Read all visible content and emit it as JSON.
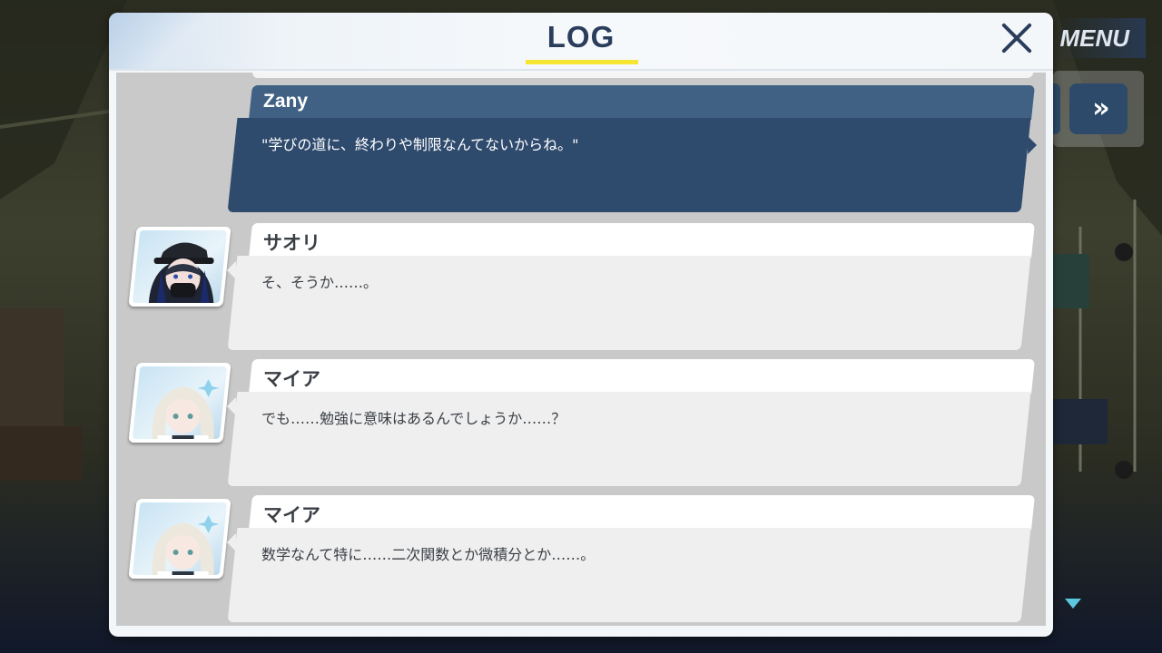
{
  "window": {
    "title": "LOG"
  },
  "top_controls": {
    "menu_label": "MENU",
    "skip_label": "»",
    "auto_label": ""
  },
  "log_entries": [
    {
      "speaker": "Zany",
      "text": "\"学びの道に、終わりや制限なんてないからね。\"",
      "type": "player"
    },
    {
      "speaker": "サオリ",
      "text": "そ、そうか……。",
      "type": "npc",
      "avatar": "saori-portrait"
    },
    {
      "speaker": "マイア",
      "text": "でも……勉強に意味はあるんでしょうか……？",
      "type": "npc",
      "avatar": "maia-portrait"
    },
    {
      "speaker": "マイア",
      "text": "数学なんて特に……二次関数とか微積分とか……。",
      "type": "npc",
      "avatar": "maia-portrait"
    }
  ],
  "colors": {
    "title_underline": "#f7e533",
    "player_bubble": "#2e4a6d",
    "player_name_bar": "#406184",
    "npc_bubble": "#efefef",
    "accent_dark": "#2a3e5c"
  },
  "icons": {
    "close": "close-icon",
    "skip": "fast-forward-icon",
    "scroll": "scroll-down-indicator-icon"
  }
}
